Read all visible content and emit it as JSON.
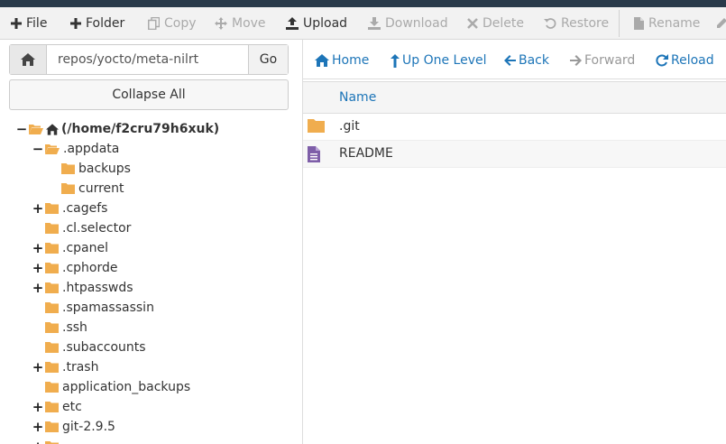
{
  "toolbar": {
    "file": "File",
    "folder": "Folder",
    "copy": "Copy",
    "move": "Move",
    "upload": "Upload",
    "download": "Download",
    "delete": "Delete",
    "restore": "Restore",
    "rename": "Rename"
  },
  "pathbar": {
    "value": "repos/yocto/meta-nilrt",
    "go": "Go"
  },
  "collapse_all": "Collapse All",
  "tree": {
    "root": "(/home/f2cru79h6xuk)",
    "nodes": [
      ".appdata",
      "backups",
      "current",
      ".cagefs",
      ".cl.selector",
      ".cpanel",
      ".cphorde",
      ".htpasswds",
      ".spamassassin",
      ".ssh",
      ".subaccounts",
      ".trash",
      "application_backups",
      "etc",
      "git-2.9.5"
    ]
  },
  "nav": {
    "home": "Home",
    "up": "Up One Level",
    "back": "Back",
    "forward": "Forward",
    "reload": "Reload"
  },
  "list": {
    "col_name": "Name",
    "rows": [
      {
        "name": ".git",
        "type": "folder"
      },
      {
        "name": "README",
        "type": "file"
      }
    ]
  },
  "colors": {
    "folder": "#f0ad4e",
    "link": "#1d75b8",
    "file_icon": "#7e5ea8",
    "header_bar": "#293a4a"
  }
}
